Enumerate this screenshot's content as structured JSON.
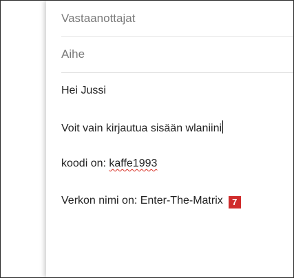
{
  "compose": {
    "recipients_placeholder": "Vastaanottajat",
    "subject_placeholder": "Aihe",
    "body": {
      "line1": "Hei Jussi",
      "line2": "Voit vain kirjautua sisään wlaniini",
      "line3_prefix": "koodi on: ",
      "line3_code": "kaffe1993",
      "line4": "Verkon nimi on: Enter-The-Matrix"
    }
  },
  "annotation_badge": "7",
  "colors": {
    "badge": "#d02c2c",
    "spellcheck_underline": "#d93025"
  }
}
